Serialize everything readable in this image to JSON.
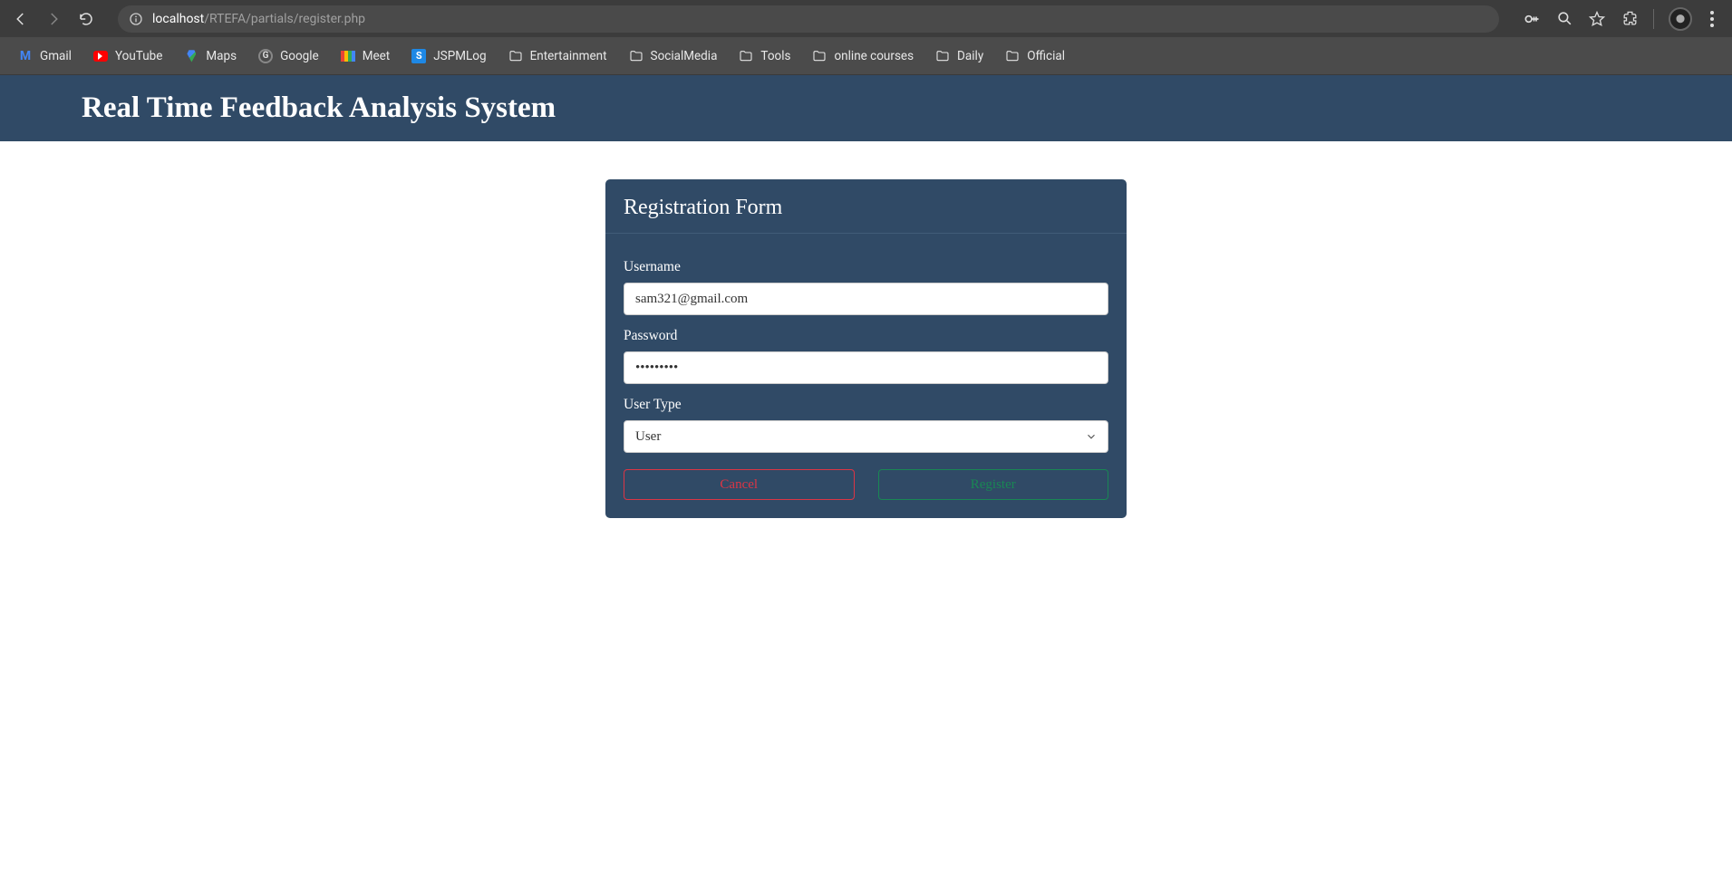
{
  "browser": {
    "url_host": "localhost",
    "url_path": "/RTEFA/partials/register.php"
  },
  "bookmarks": [
    {
      "label": "Gmail",
      "icon": "gmail"
    },
    {
      "label": "YouTube",
      "icon": "youtube"
    },
    {
      "label": "Maps",
      "icon": "maps"
    },
    {
      "label": "Google",
      "icon": "google"
    },
    {
      "label": "Meet",
      "icon": "meet"
    },
    {
      "label": "JSPMLog",
      "icon": "sbadge"
    },
    {
      "label": "Entertainment",
      "icon": "folder"
    },
    {
      "label": "SocialMedia",
      "icon": "folder"
    },
    {
      "label": "Tools",
      "icon": "folder"
    },
    {
      "label": "online courses",
      "icon": "folder"
    },
    {
      "label": "Daily",
      "icon": "folder"
    },
    {
      "label": "Official",
      "icon": "folder"
    }
  ],
  "header": {
    "title": "Real Time Feedback Analysis System"
  },
  "form": {
    "title": "Registration Form",
    "username_label": "Username",
    "username_value": "sam321@gmail.com",
    "password_label": "Password",
    "password_value": "•••••••••",
    "usertype_label": "User Type",
    "usertype_value": "User",
    "cancel_label": "Cancel",
    "register_label": "Register"
  }
}
